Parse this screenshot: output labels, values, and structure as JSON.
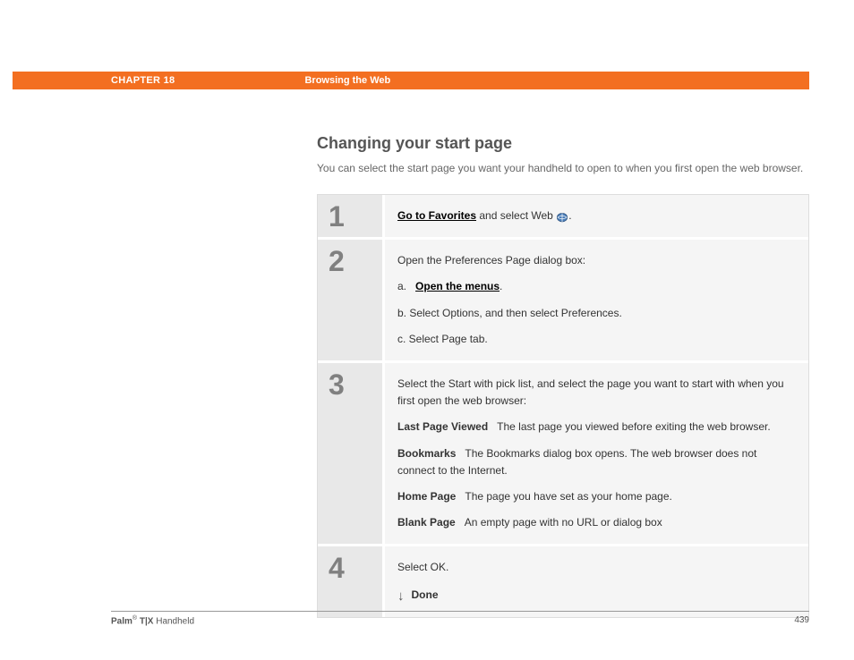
{
  "header": {
    "chapter": "CHAPTER 18",
    "breadcrumb": "Browsing the Web"
  },
  "section": {
    "title": "Changing your start page",
    "intro": "You can select the start page you want your handheld to open to when you first open the web browser."
  },
  "steps": {
    "s1": {
      "num": "1",
      "link": "Go to Favorites",
      "after": " and select Web ",
      "period": "."
    },
    "s2": {
      "num": "2",
      "lead": "Open the Preferences Page dialog box:",
      "a_prefix": "a.",
      "a_link": "Open the menus",
      "a_suffix": ".",
      "b": "b.   Select Options, and then select Preferences.",
      "c": "c.   Select Page tab."
    },
    "s3": {
      "num": "3",
      "lead": "Select the Start with pick list, and select the page you want to start with when you first open the web browser:",
      "t1": "Last Page Viewed",
      "d1": "The last page you viewed before exiting the web browser.",
      "t2": "Bookmarks",
      "d2": "The Bookmarks dialog box opens. The web browser does not connect to the Internet.",
      "t3": "Home Page",
      "d3": "The page you have set as your home page.",
      "t4": "Blank Page",
      "d4": "An empty page with no URL or dialog box"
    },
    "s4": {
      "num": "4",
      "text": "Select OK.",
      "done": "Done"
    }
  },
  "footer": {
    "brand_bold": "Palm",
    "reg": "®",
    "model": " T|X",
    "product": " Handheld",
    "page": "439"
  }
}
